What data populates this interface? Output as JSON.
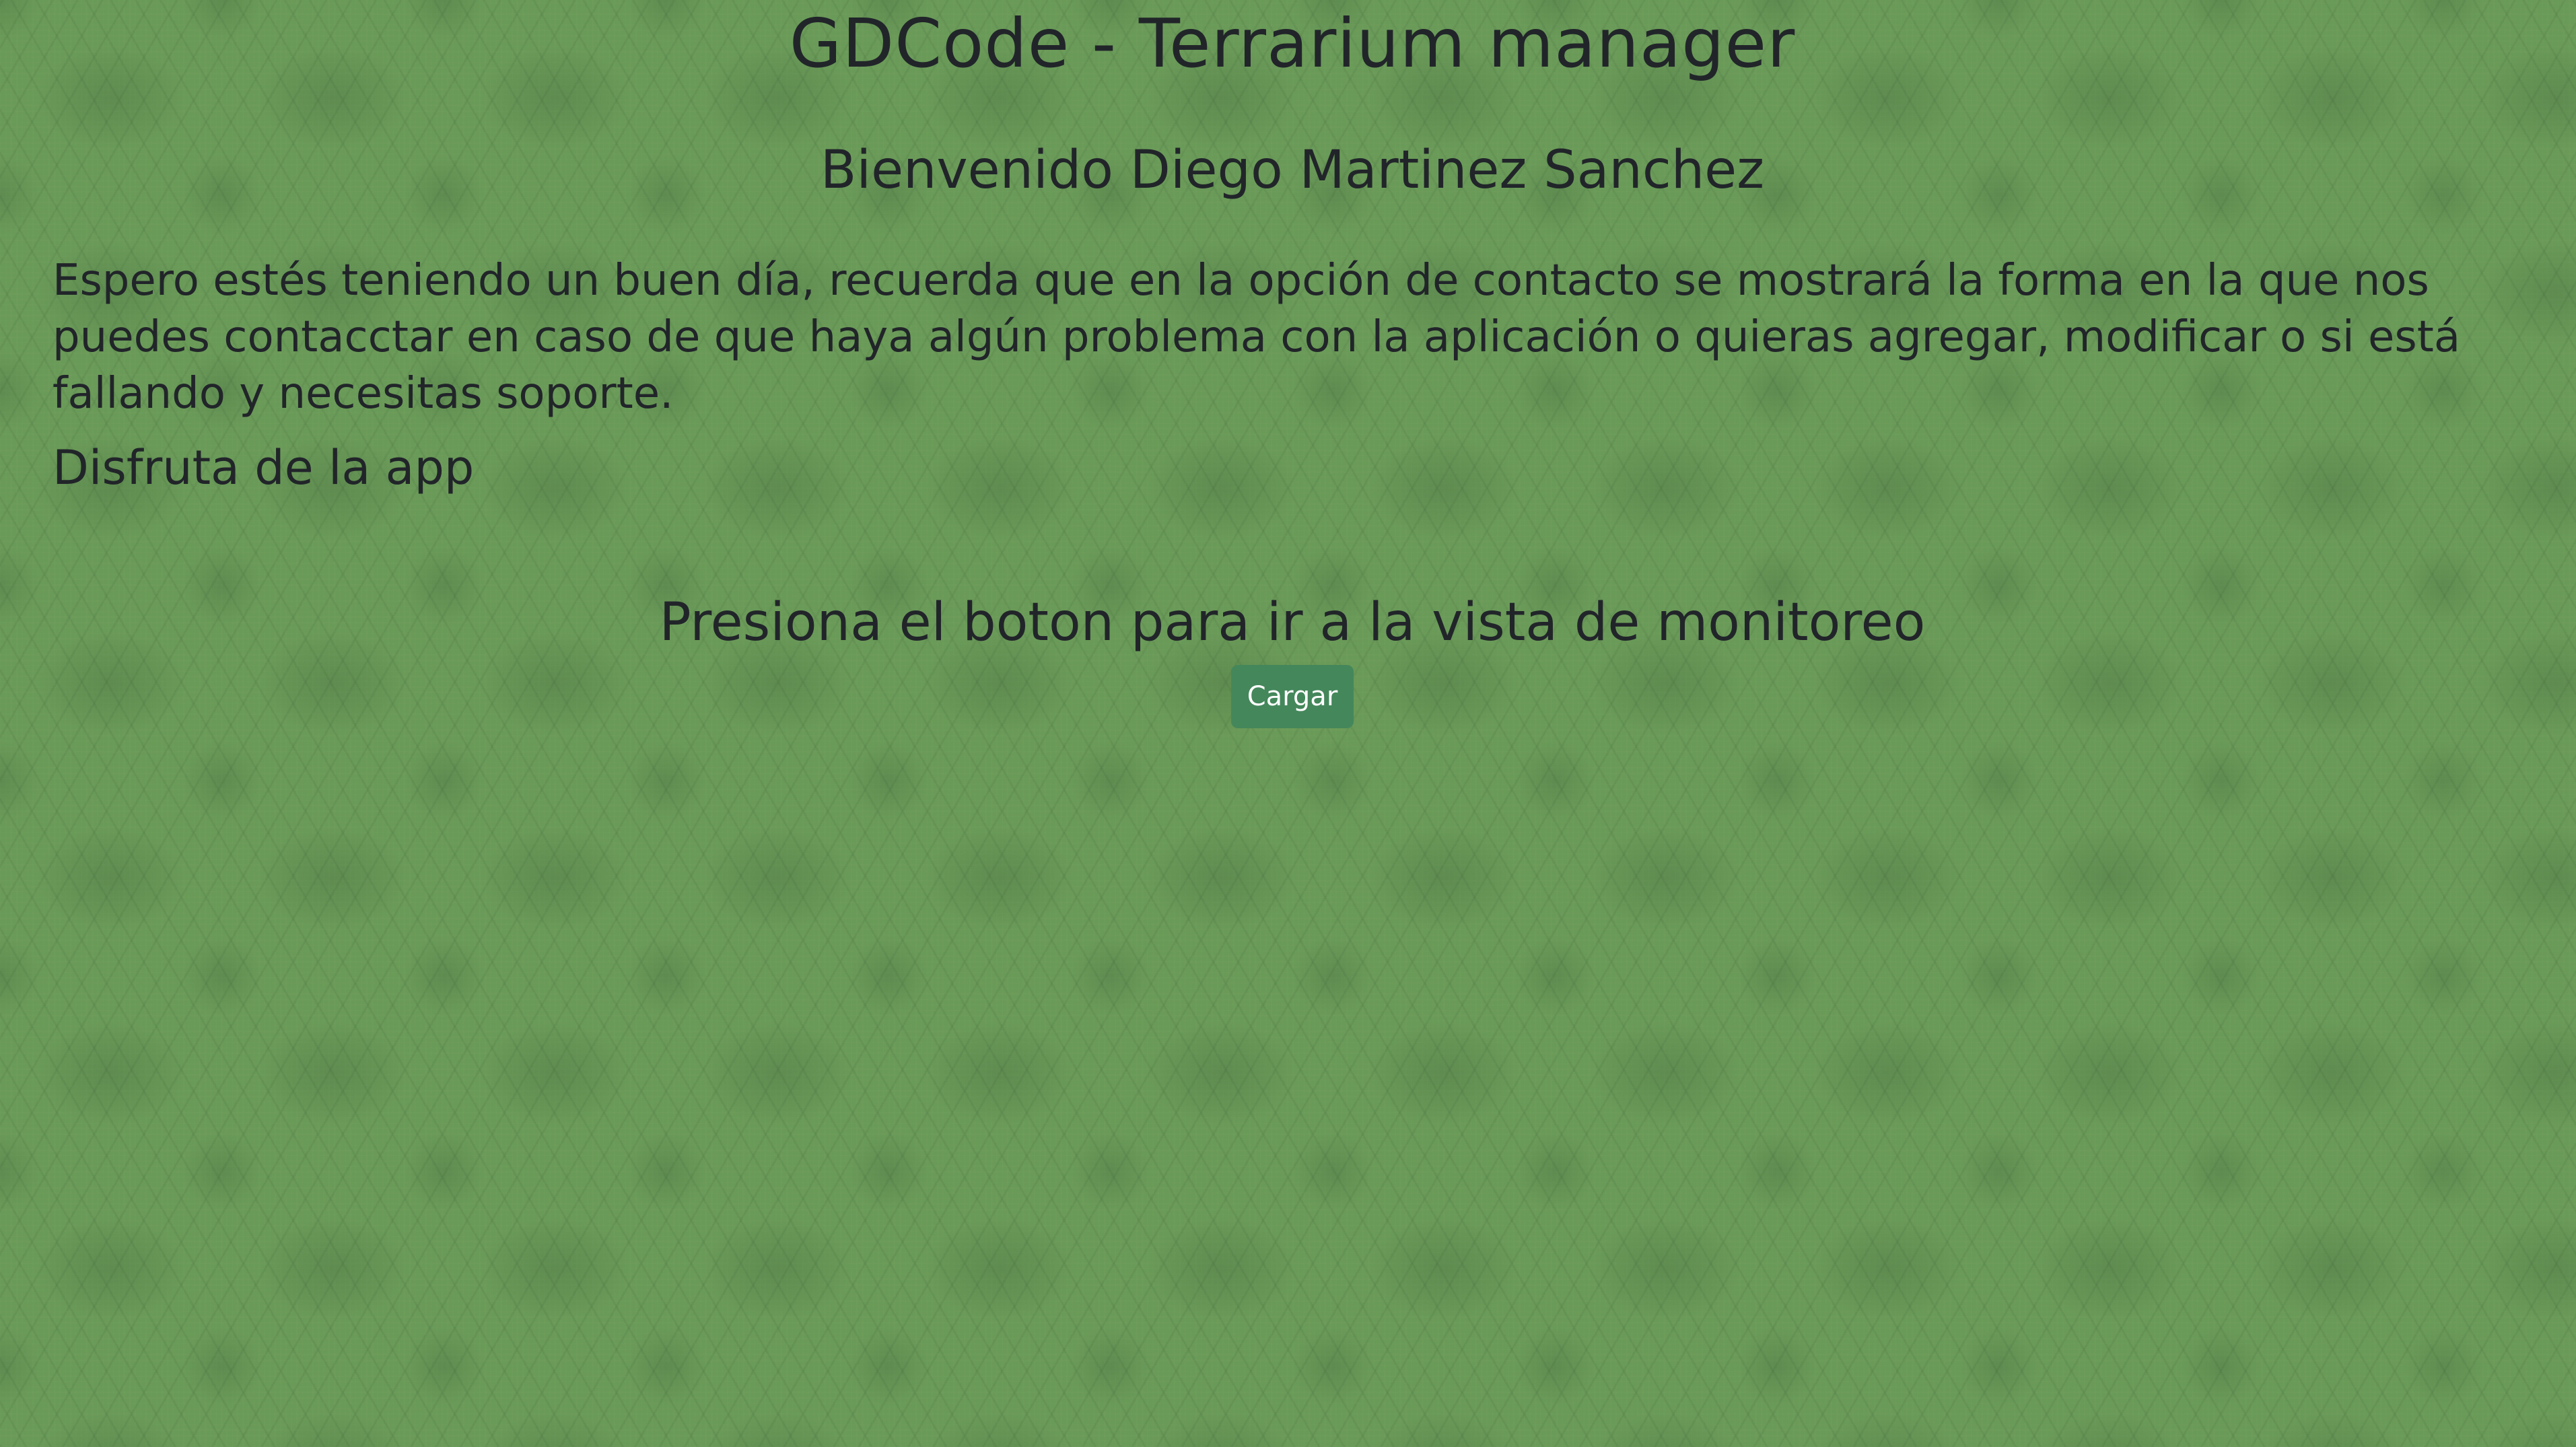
{
  "header": {
    "title": "GDCode - Terrarium manager",
    "welcome": "Bienvenido Diego Martinez Sanchez"
  },
  "main": {
    "intro_text": "Espero estés teniendo un buen día, recuerda que en la opción de contacto se mostrará la forma en la que nos puedes contacctar en caso de que haya algún problema con la aplicación o quieras agregar, modificar o si está fallando y necesitas soporte.",
    "enjoy_text": "Disfruta de la app",
    "instruction": "Presiona el boton para ir a la vista de monitoreo",
    "load_button_label": "Cargar"
  },
  "colors": {
    "background": "#6a9a58",
    "text": "#212529",
    "button": "#44875b",
    "button_text": "#ffffff"
  }
}
